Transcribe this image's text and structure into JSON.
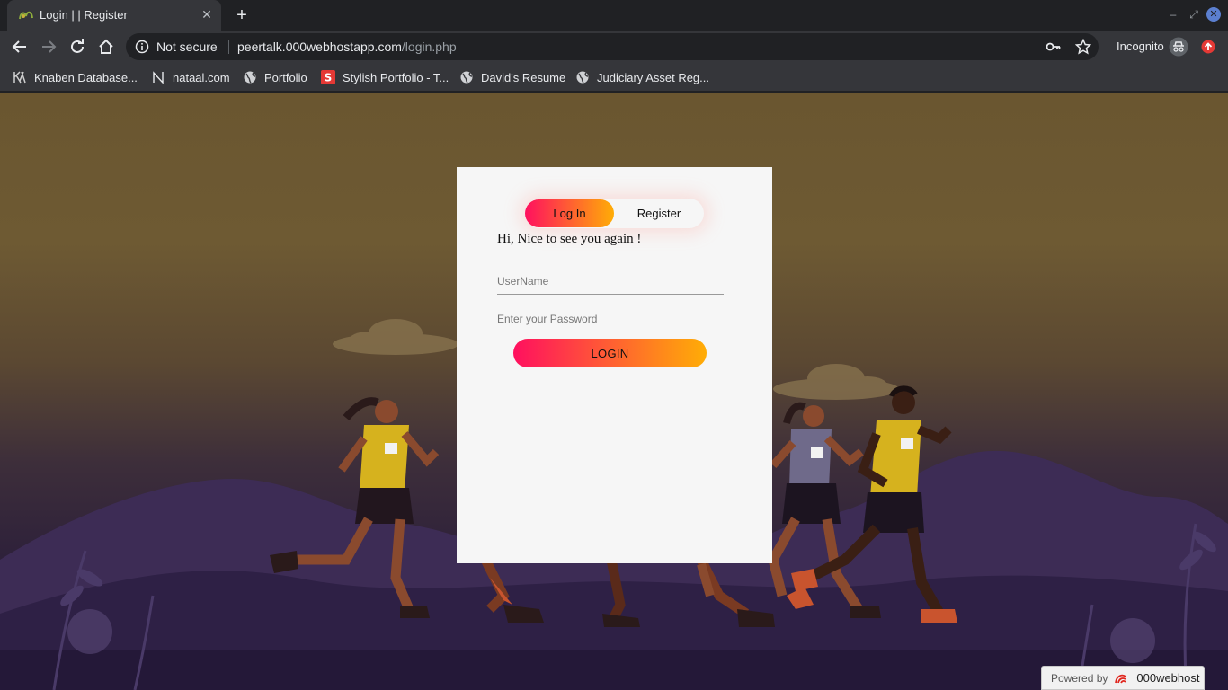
{
  "browser": {
    "tab": {
      "title": "Login | | Register",
      "close": "✕"
    },
    "new_tab": "+",
    "window": {
      "minimize": "–",
      "maximize": "⤢",
      "close": "✕"
    },
    "security_label": "Not secure",
    "url": {
      "host": "peertalk.000webhostapp.com",
      "path": "/login.php"
    },
    "incognito_label": "Incognito",
    "bookmarks": [
      {
        "label": "Knaben Database...",
        "icon": "knaben-icon"
      },
      {
        "label": "nataal.com",
        "icon": "nataal-icon"
      },
      {
        "label": "Portfolio",
        "icon": "globe-icon"
      },
      {
        "label": "Stylish Portfolio - T...",
        "icon": "s-logo-icon"
      },
      {
        "label": "David's Resume",
        "icon": "globe-icon"
      },
      {
        "label": "Judiciary Asset Reg...",
        "icon": "globe-icon"
      }
    ]
  },
  "login": {
    "tabs": {
      "login": "Log In",
      "register": "Register",
      "active": "login"
    },
    "greeting": "Hi, Nice to see you again !",
    "username_placeholder": "UserName",
    "password_placeholder": "Enter your Password",
    "submit": "LOGIN"
  },
  "footer": {
    "powered_by": "Powered by",
    "brand": "000webhost"
  },
  "colors": {
    "gradient_start": "#ff105f",
    "gradient_end": "#ffad06",
    "card_bg": "#f6f6f6",
    "chrome_bg": "#35363a"
  }
}
